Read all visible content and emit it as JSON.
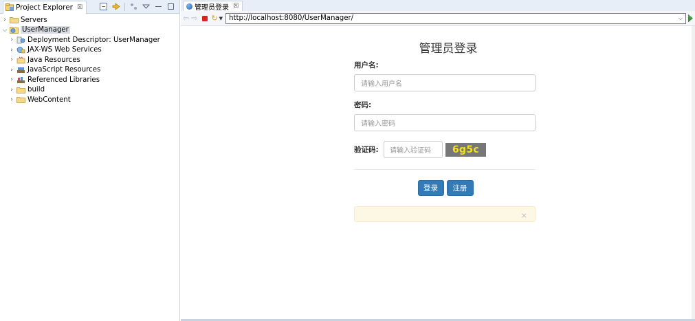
{
  "project_explorer": {
    "tab_title": "Project Explorer",
    "close_glyph": "☒",
    "tree": [
      {
        "label": "Servers",
        "expanded": false,
        "selected": false,
        "indent": 0,
        "icon": "folder-icon"
      },
      {
        "label": "UserManager",
        "expanded": true,
        "selected": true,
        "indent": 0,
        "icon": "web-project-icon"
      },
      {
        "label": "Deployment Descriptor: UserManager",
        "expanded": false,
        "selected": false,
        "indent": 1,
        "icon": "deployment-descriptor-icon"
      },
      {
        "label": "JAX-WS Web Services",
        "expanded": false,
        "selected": false,
        "indent": 1,
        "icon": "web-services-icon"
      },
      {
        "label": "Java Resources",
        "expanded": false,
        "selected": false,
        "indent": 1,
        "icon": "java-resources-icon"
      },
      {
        "label": "JavaScript Resources",
        "expanded": false,
        "selected": false,
        "indent": 1,
        "icon": "javascript-resources-icon"
      },
      {
        "label": "Referenced Libraries",
        "expanded": false,
        "selected": false,
        "indent": 1,
        "icon": "library-icon"
      },
      {
        "label": "build",
        "expanded": false,
        "selected": false,
        "indent": 1,
        "icon": "folder-icon"
      },
      {
        "label": "WebContent",
        "expanded": false,
        "selected": false,
        "indent": 1,
        "icon": "folder-icon"
      }
    ]
  },
  "browser": {
    "tab_title": "管理员登录",
    "close_glyph": "☒",
    "url": "http://localhost:8080/UserManager/"
  },
  "login": {
    "title": "管理员登录",
    "username_label": "用户名:",
    "username_placeholder": "请输入用户名",
    "password_label": "密码:",
    "password_placeholder": "请输入密码",
    "captcha_label": "验证码:",
    "captcha_placeholder": "请输入验证码",
    "captcha_code": "6g5c",
    "login_button": "登录",
    "register_button": "注册",
    "alert_close": "×"
  },
  "colors": {
    "primary_button": "#337ab7",
    "alert_bg": "#fcf8e3",
    "captcha_bg": "#777777",
    "captcha_text": "#f3e21a"
  }
}
